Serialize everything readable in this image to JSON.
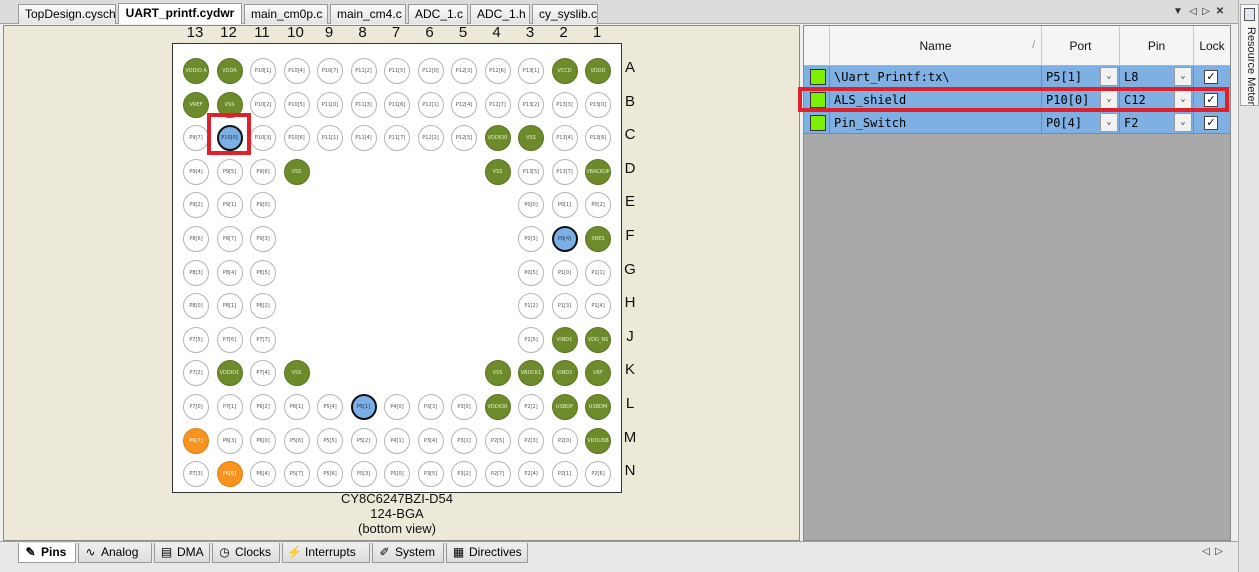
{
  "doc_tabs": [
    {
      "label": "TopDesign.cysch",
      "active": false
    },
    {
      "label": "UART_printf.cydwr",
      "active": true
    },
    {
      "label": "main_cm0p.c",
      "active": false
    },
    {
      "label": "main_cm4.c",
      "active": false
    },
    {
      "label": "ADC_1.c",
      "active": false
    },
    {
      "label": "ADC_1.h",
      "active": false
    },
    {
      "label": "cy_syslib.c",
      "active": false
    }
  ],
  "tab_controls": {
    "dropdown": "▼",
    "prev": "◁",
    "next": "▷",
    "close": "✕"
  },
  "side_panel": {
    "label": "Resource Meter"
  },
  "package": {
    "columns": [
      "13",
      "12",
      "11",
      "10",
      "9",
      "8",
      "7",
      "6",
      "5",
      "4",
      "3",
      "2",
      "1"
    ],
    "rows": [
      "A",
      "B",
      "C",
      "D",
      "E",
      "F",
      "G",
      "H",
      "J",
      "K",
      "L",
      "M",
      "N"
    ],
    "caption_line1": "CY8C6247BZI-D54",
    "caption_line2": "124-BGA",
    "caption_line3": "(bottom view)",
    "balls": [
      [
        "VDDIO A",
        "VDDA",
        "P10[1]",
        "P10[4]",
        "P10[7]",
        "P11[2]",
        "P11[5]",
        "P12[0]",
        "P12[3]",
        "P12[6]",
        "P13[1]",
        "VCCD",
        "VDDD"
      ],
      [
        "VREF",
        "VSS",
        "P10[2]",
        "P10[5]",
        "P11[0]",
        "P11[3]",
        "P11[6]",
        "P12[1]",
        "P12[4]",
        "P12[7]",
        "P13[2]",
        "P13[3]",
        "P13[0]"
      ],
      [
        "P9[7]",
        "P10[0]",
        "P10[3]",
        "P10[6]",
        "P11[1]",
        "P11[4]",
        "P11[7]",
        "P12[2]",
        "P12[5]",
        "VDDIO0",
        "VSS",
        "P13[4]",
        "P13[6]"
      ],
      [
        "P9[4]",
        "P9[5]",
        "P9[6]",
        "VSS",
        "",
        "",
        "",
        "",
        "",
        "VSS",
        "P13[5]",
        "P13[7]",
        "VBACKUP"
      ],
      [
        "P9[2]",
        "P9[1]",
        "P9[0]",
        "",
        "",
        "",
        "",
        "",
        "",
        "",
        "P0[0]",
        "P0[1]",
        "P0[2]"
      ],
      [
        "P8[6]",
        "P8[7]",
        "P9[3]",
        "",
        "",
        "",
        "",
        "",
        "",
        "",
        "P0[3]",
        "P0[4]",
        "XRES"
      ],
      [
        "P8[3]",
        "P8[4]",
        "P8[5]",
        "",
        "",
        "",
        "",
        "",
        "",
        "",
        "P0[5]",
        "P1[0]",
        "P1[1]"
      ],
      [
        "P8[0]",
        "P8[1]",
        "P8[2]",
        "",
        "",
        "",
        "",
        "",
        "",
        "",
        "P1[2]",
        "P1[3]",
        "P1[4]"
      ],
      [
        "P7[5]",
        "P7[6]",
        "P7[7]",
        "",
        "",
        "",
        "",
        "",
        "",
        "",
        "P1[5]",
        "VIND1",
        "VDD_NS"
      ],
      [
        "P7[2]",
        "VDDIO1",
        "P7[4]",
        "VSS",
        "",
        "",
        "",
        "",
        "",
        "VSS",
        "VBUCK1",
        "VIND2",
        "VRF"
      ],
      [
        "P7[0]",
        "P7[1]",
        "P6[2]",
        "P6[1]",
        "P5[4]",
        "P5[1]",
        "P4[0]",
        "P3[3]",
        "P3[0]",
        "VDDIOR",
        "P2[2]",
        "USBDP",
        "USBDM"
      ],
      [
        "P6[7]",
        "P6[3]",
        "P6[0]",
        "P5[6]",
        "P5[5]",
        "P5[2]",
        "P4[1]",
        "P3[4]",
        "P3[1]",
        "P2[5]",
        "P2[3]",
        "P2[0]",
        "VDDUSB"
      ],
      [
        "P7[3]",
        "P6[6]",
        "P6[4]",
        "P5[7]",
        "P5[6]",
        "P5[3]",
        "P5[0]",
        "P3[5]",
        "P3[2]",
        "P2[7]",
        "P2[4]",
        "P2[1]",
        "P2[6]"
      ]
    ],
    "power_color": "#6e8b2c",
    "assigned_color": "#7ab0e6",
    "orange_color": "#f7931e"
  },
  "pin_table": {
    "headers": {
      "name": "Name",
      "port": "Port",
      "pin": "Pin",
      "lock": "Lock"
    },
    "rows": [
      {
        "name": "\\Uart_Printf:tx\\",
        "port": "P5[1]",
        "pin": "L8",
        "locked": true
      },
      {
        "name": "ALS_shield",
        "port": "P10[0]",
        "pin": "C12",
        "locked": true
      },
      {
        "name": "Pin_Switch",
        "port": "P0[4]",
        "pin": "F2",
        "locked": true
      }
    ],
    "dropdown_glyph": "⌄",
    "check_glyph": "✓",
    "swatch_color": "#7cf000"
  },
  "bottom_tabs": [
    {
      "label": "Pins",
      "icon": "pins-icon",
      "glyph": "✎",
      "active": true
    },
    {
      "label": "Analog",
      "icon": "analog-icon",
      "glyph": "∿",
      "active": false
    },
    {
      "label": "DMA",
      "icon": "dma-icon",
      "glyph": "▤",
      "active": false
    },
    {
      "label": "Clocks",
      "icon": "clock-icon",
      "glyph": "◷",
      "active": false
    },
    {
      "label": "Interrupts",
      "icon": "interrupt-icon",
      "glyph": "⚡",
      "active": false
    },
    {
      "label": "System",
      "icon": "system-icon",
      "glyph": "✐",
      "active": false
    },
    {
      "label": "Directives",
      "icon": "directives-icon",
      "glyph": "▦",
      "active": false
    }
  ],
  "bottom_controls": {
    "prev": "◁",
    "next": "▷"
  }
}
